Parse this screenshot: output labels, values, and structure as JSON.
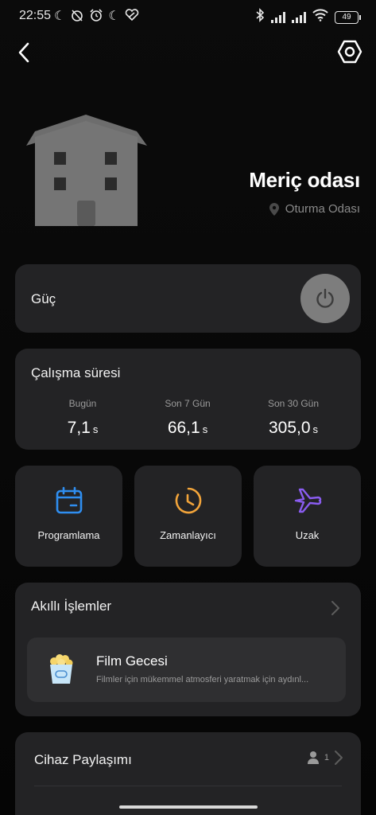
{
  "status_bar": {
    "time": "22:55",
    "battery": "49",
    "left_icons": [
      "moon-icon",
      "alarm-off-icon",
      "alarm-icon",
      "moon-icon",
      "app-icon"
    ],
    "right_icons": [
      "bluetooth-icon",
      "signal-icon",
      "signal-icon",
      "wifi-icon",
      "battery-icon"
    ]
  },
  "header": {
    "device_name": "Meriç odası",
    "location": "Oturma Odası"
  },
  "power": {
    "label": "Güç",
    "state": "off"
  },
  "runtime": {
    "title": "Çalışma süresi",
    "stats": [
      {
        "label": "Bugün",
        "value": "7,1",
        "unit": "s"
      },
      {
        "label": "Son 7 Gün",
        "value": "66,1",
        "unit": "s"
      },
      {
        "label": "Son 30 Gün",
        "value": "305,0",
        "unit": "s"
      }
    ]
  },
  "tiles": [
    {
      "label": "Programlama",
      "icon": "calendar-icon",
      "color": "#2f8ef0"
    },
    {
      "label": "Zamanlayıcı",
      "icon": "clock-icon",
      "color": "#f2a43a"
    },
    {
      "label": "Uzak",
      "icon": "airplane-icon",
      "color": "#8a5cf0"
    }
  ],
  "smart": {
    "title": "Akıllı İşlemler",
    "scene": {
      "title": "Film Gecesi",
      "description": "Filmler için mükemmel atmosferi yaratmak için aydınl..."
    }
  },
  "share": {
    "title": "Cihaz Paylaşımı",
    "count": "1"
  },
  "colors": {
    "background": "#050505",
    "card": "#232325",
    "scene_card": "#2f2f31",
    "power_button": "#7d7d7d"
  }
}
